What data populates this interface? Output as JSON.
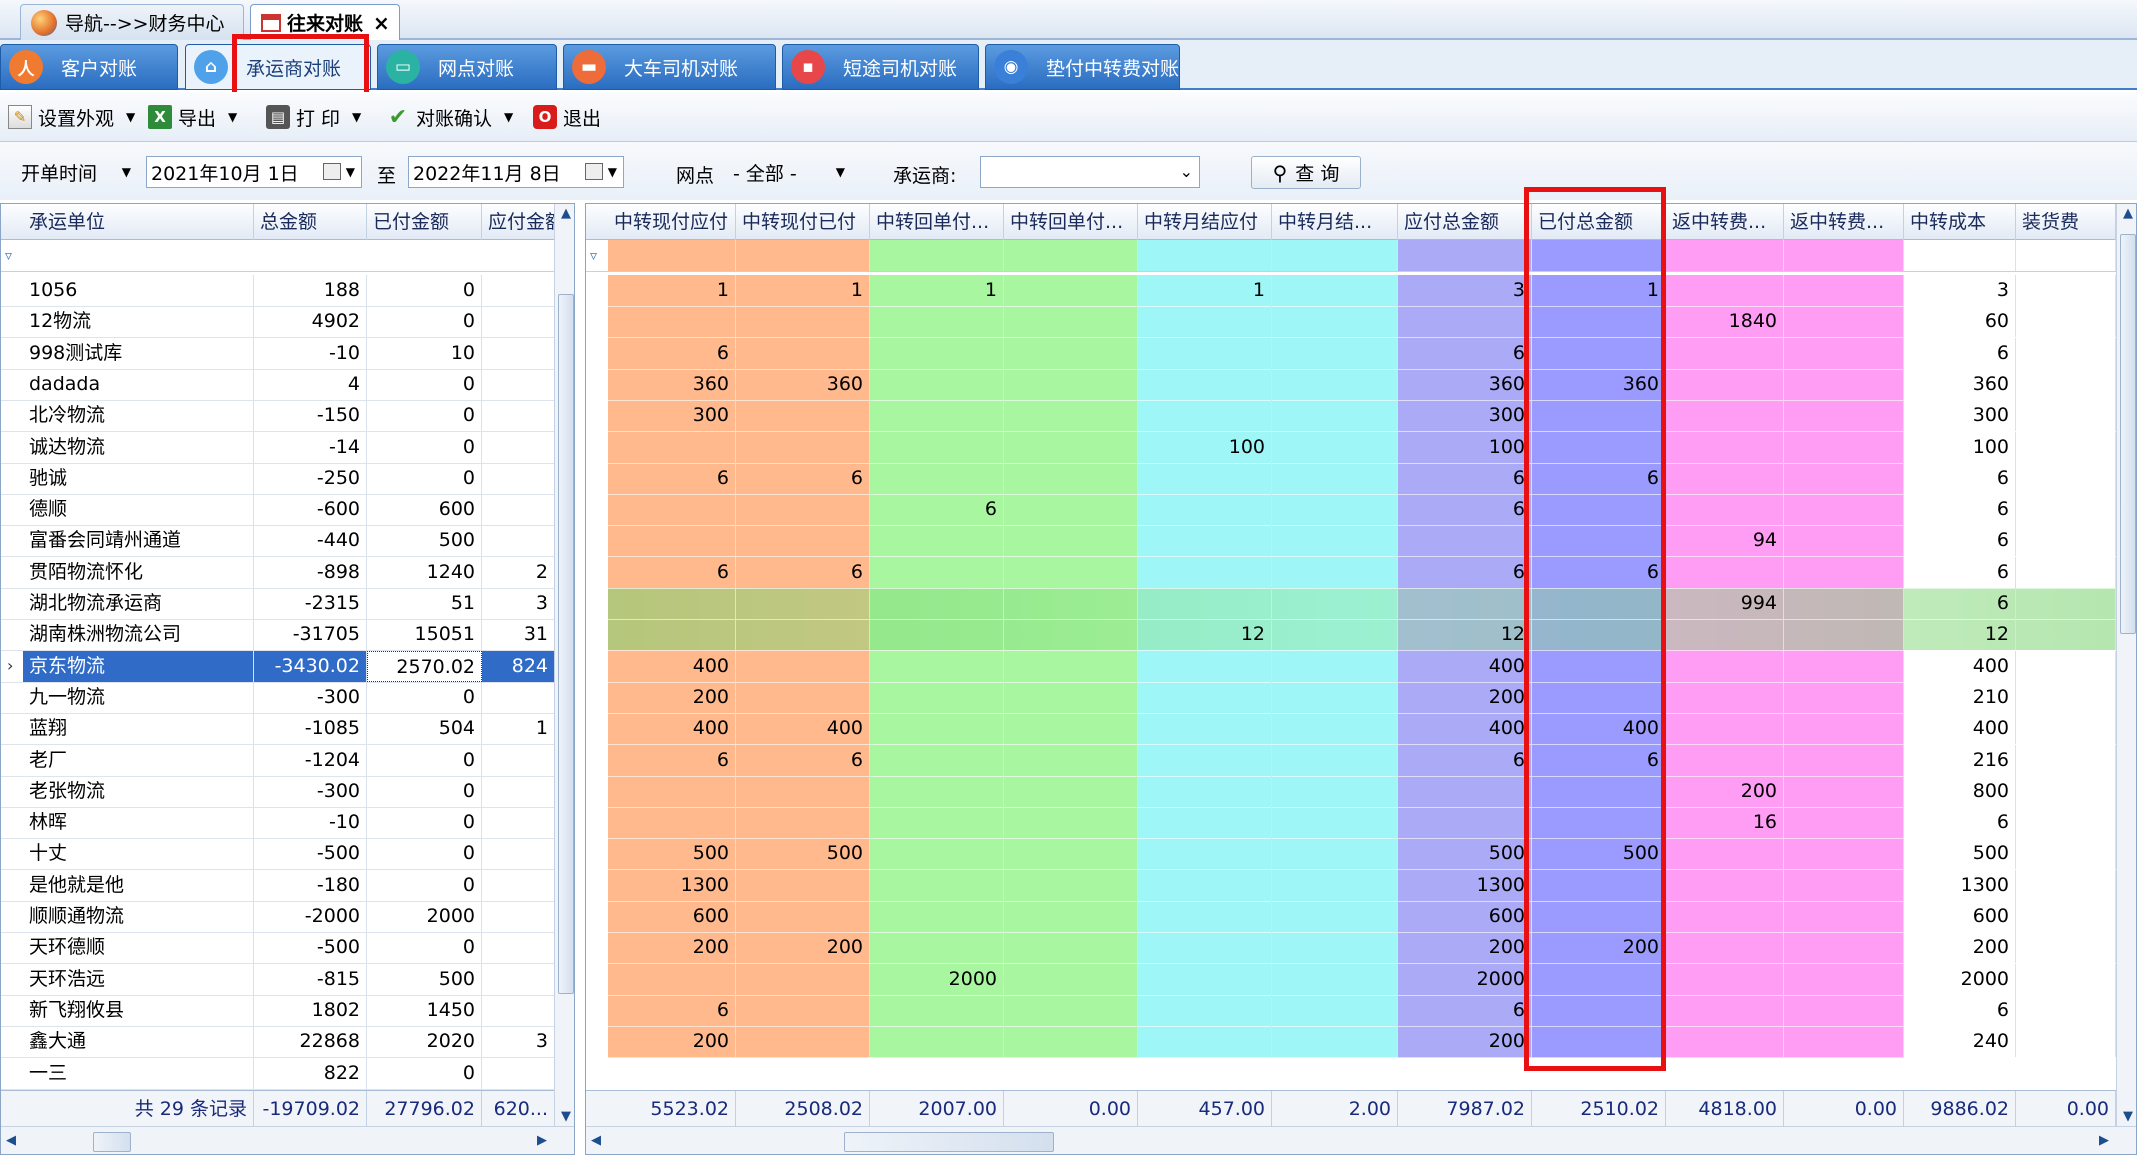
{
  "doc_tabs": [
    {
      "label": "导航-->>财务中心"
    },
    {
      "label": "往来对账"
    }
  ],
  "module_tabs": [
    {
      "label": "客户对账",
      "color": "#f07a2f",
      "glyph": "人"
    },
    {
      "label": "承运商对账",
      "color": "#4fa1ea",
      "glyph": "⌂"
    },
    {
      "label": "网点对账",
      "color": "#2ab3a2",
      "glyph": "▭"
    },
    {
      "label": "大车司机对账",
      "color": "#ee6b3a",
      "glyph": "▬"
    },
    {
      "label": "短途司机对账",
      "color": "#e8474a",
      "glyph": "▪"
    },
    {
      "label": "垫付中转费对账",
      "color": "#3a7fd8",
      "glyph": "◉"
    }
  ],
  "toolbar": {
    "items": [
      {
        "label": "设置外观",
        "icon": "edit-icon",
        "has_dropdown": true
      },
      {
        "label": "导出",
        "icon": "excel-icon",
        "has_dropdown": true
      },
      {
        "label": "打 印",
        "icon": "printer-icon",
        "has_dropdown": true
      },
      {
        "label": "对账确认",
        "icon": "checkmark-icon",
        "has_dropdown": true
      },
      {
        "label": "退出",
        "icon": "power-icon",
        "has_dropdown": false
      }
    ]
  },
  "filters": {
    "date_type": "开单时间",
    "date_from": "2021年10月 1日",
    "to_label": "至",
    "date_to": "2022年11月 8日",
    "outlet_label": "网点",
    "outlet_value": "- 全部 -",
    "carrier_label": "承运商:",
    "carrier_value": "",
    "query_label": "查 询"
  },
  "left_grid": {
    "columns": [
      "承运单位",
      "总金额",
      "已付金额",
      "应付金额"
    ],
    "rows": [
      [
        "1056",
        "188",
        "0",
        ""
      ],
      [
        "12物流",
        "4902",
        "0",
        ""
      ],
      [
        "998测试库",
        "-10",
        "10",
        ""
      ],
      [
        "dadada",
        "4",
        "0",
        ""
      ],
      [
        "北冷物流",
        "-150",
        "0",
        ""
      ],
      [
        "诚达物流",
        "-14",
        "0",
        ""
      ],
      [
        "驰诚",
        "-250",
        "0",
        ""
      ],
      [
        "德顺",
        "-600",
        "600",
        ""
      ],
      [
        "富番会同靖州通道",
        "-440",
        "500",
        ""
      ],
      [
        "贯陌物流怀化",
        "-898",
        "1240",
        "2"
      ],
      [
        "湖北物流承运商",
        "-2315",
        "51",
        "3"
      ],
      [
        "湖南株洲物流公司",
        "-31705",
        "15051",
        "31"
      ],
      [
        "京东物流",
        "-3430.02",
        "2570.02",
        "824"
      ],
      [
        "九一物流",
        "-300",
        "0",
        ""
      ],
      [
        "蓝翔",
        "-1085",
        "504",
        "1"
      ],
      [
        "老厂",
        "-1204",
        "0",
        ""
      ],
      [
        "老张物流",
        "-300",
        "0",
        ""
      ],
      [
        "林晖",
        "-10",
        "0",
        ""
      ],
      [
        "十丈",
        "-500",
        "0",
        ""
      ],
      [
        "是他就是他",
        "-180",
        "0",
        ""
      ],
      [
        "顺顺通物流",
        "-2000",
        "2000",
        ""
      ],
      [
        "天环德顺",
        "-500",
        "0",
        ""
      ],
      [
        "天环浩远",
        "-815",
        "500",
        ""
      ],
      [
        "新飞翔攸县",
        "1802",
        "1450",
        ""
      ],
      [
        "鑫大通",
        "22868",
        "2020",
        "3"
      ],
      [
        "一三",
        "822",
        "0",
        ""
      ]
    ],
    "selected_index": 12,
    "footer": [
      "共 29 条记录",
      "-19709.02",
      "27796.02",
      "620..."
    ]
  },
  "right_grid": {
    "columns": [
      "中转现付应付",
      "中转现付已付",
      "中转回单付...",
      "中转回单付...",
      "中转月结应付",
      "中转月结...",
      "应付总金额",
      "已付总金额",
      "返中转费...",
      "返中转费...",
      "中转成本",
      "装货费"
    ],
    "col_colors": [
      "#ffb98c",
      "#ffb98c",
      "#a8f7a0",
      "#a8f7a0",
      "#9ef6f6",
      "#9ef6f6",
      "#aaaaf6",
      "#9b9bff",
      "#ff9cf3",
      "#ff9cf3",
      "#ffffff",
      "#ffffff"
    ],
    "rows": [
      [
        "1",
        "1",
        "1",
        "",
        "1",
        "",
        "3",
        "1",
        "",
        "",
        "3",
        ""
      ],
      [
        "",
        "",
        "",
        "",
        "",
        "",
        "",
        "",
        "1840",
        "",
        "60",
        ""
      ],
      [
        "6",
        "",
        "",
        "",
        "",
        "",
        "6",
        "",
        "",
        "",
        "6",
        ""
      ],
      [
        "360",
        "360",
        "",
        "",
        "",
        "",
        "360",
        "360",
        "",
        "",
        "360",
        ""
      ],
      [
        "300",
        "",
        "",
        "",
        "",
        "",
        "300",
        "",
        "",
        "",
        "300",
        ""
      ],
      [
        "",
        "",
        "",
        "",
        "100",
        "",
        "100",
        "",
        "",
        "",
        "100",
        ""
      ],
      [
        "6",
        "6",
        "",
        "",
        "",
        "",
        "6",
        "6",
        "",
        "",
        "6",
        ""
      ],
      [
        "",
        "",
        "6",
        "",
        "",
        "",
        "6",
        "",
        "",
        "",
        "6",
        ""
      ],
      [
        "",
        "",
        "",
        "",
        "",
        "",
        "",
        "",
        "94",
        "",
        "6",
        ""
      ],
      [
        "6",
        "6",
        "",
        "",
        "",
        "",
        "6",
        "6",
        "",
        "",
        "6",
        ""
      ],
      [
        "",
        "",
        "",
        "",
        "",
        "",
        "",
        "",
        "994",
        "",
        "6",
        ""
      ],
      [
        "",
        "",
        "",
        "",
        "12",
        "",
        "12",
        "",
        "",
        "",
        "12",
        ""
      ],
      [
        "400",
        "",
        "",
        "",
        "",
        "",
        "400",
        "",
        "",
        "",
        "400",
        ""
      ],
      [
        "200",
        "",
        "",
        "",
        "",
        "",
        "200",
        "",
        "",
        "",
        "210",
        ""
      ],
      [
        "400",
        "400",
        "",
        "",
        "",
        "",
        "400",
        "400",
        "",
        "",
        "400",
        ""
      ],
      [
        "6",
        "6",
        "",
        "",
        "",
        "",
        "6",
        "6",
        "",
        "",
        "216",
        ""
      ],
      [
        "",
        "",
        "",
        "",
        "",
        "",
        "",
        "",
        "200",
        "",
        "800",
        ""
      ],
      [
        "",
        "",
        "",
        "",
        "",
        "",
        "",
        "",
        "16",
        "",
        "6",
        ""
      ],
      [
        "500",
        "500",
        "",
        "",
        "",
        "",
        "500",
        "500",
        "",
        "",
        "500",
        ""
      ],
      [
        "1300",
        "",
        "",
        "",
        "",
        "",
        "1300",
        "",
        "",
        "",
        "1300",
        ""
      ],
      [
        "600",
        "",
        "",
        "",
        "",
        "",
        "600",
        "",
        "",
        "",
        "600",
        ""
      ],
      [
        "200",
        "200",
        "",
        "",
        "",
        "",
        "200",
        "200",
        "",
        "",
        "200",
        ""
      ],
      [
        "",
        "",
        "2000",
        "",
        "",
        "",
        "2000",
        "",
        "",
        "",
        "2000",
        ""
      ],
      [
        "6",
        "",
        "",
        "",
        "",
        "",
        "6",
        "",
        "",
        "",
        "6",
        ""
      ],
      [
        "200",
        "",
        "",
        "",
        "",
        "",
        "200",
        "",
        "",
        "",
        "240",
        ""
      ]
    ],
    "footer": [
      "5523.02",
      "2508.02",
      "2007.00",
      "0.00",
      "457.00",
      "2.00",
      "7987.02",
      "2510.02",
      "4818.00",
      "0.00",
      "9886.02",
      "0.00"
    ]
  }
}
